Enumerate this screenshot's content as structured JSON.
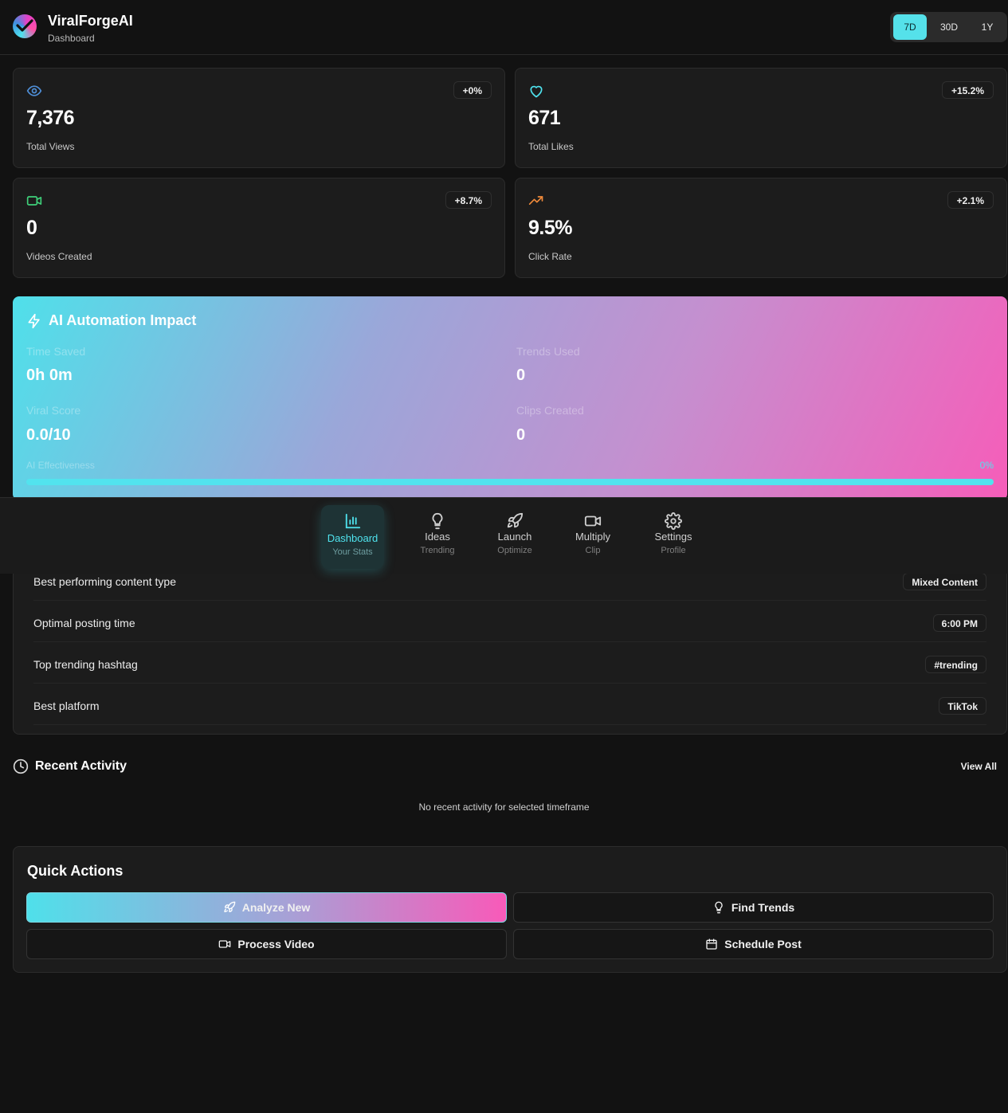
{
  "header": {
    "app_name": "ViralForgeAI",
    "subtitle": "Dashboard",
    "ranges": [
      {
        "label": "7D",
        "active": true
      },
      {
        "label": "30D",
        "active": false
      },
      {
        "label": "1Y",
        "active": false
      }
    ]
  },
  "stats": [
    {
      "icon": "eye-icon",
      "value": "7,376",
      "label": "Total Views",
      "change": "+0%",
      "color": "#4f8fd8"
    },
    {
      "icon": "heart-icon",
      "value": "671",
      "label": "Total Likes",
      "change": "+15.2%",
      "color": "#4fe3ee"
    },
    {
      "icon": "video-icon",
      "value": "0",
      "label": "Videos Created",
      "change": "+8.7%",
      "color": "#3fd07a"
    },
    {
      "icon": "trending-up-icon",
      "value": "9.5%",
      "label": "Click Rate",
      "change": "+2.1%",
      "color": "#f08a3a"
    }
  ],
  "impact": {
    "title": "AI Automation Impact",
    "metrics": [
      {
        "label": "Time Saved",
        "value": "0h 0m"
      },
      {
        "label": "Trends Used",
        "value": "0"
      },
      {
        "label": "Viral Score",
        "value": "0.0/10"
      },
      {
        "label": "Clips Created",
        "value": "0"
      }
    ],
    "effectiveness_label": "AI Effectiveness",
    "effectiveness_value": "0%",
    "effectiveness_fraction": 0
  },
  "nav": [
    {
      "icon": "bar-chart-icon",
      "label": "Dashboard",
      "sub": "Your Stats",
      "active": true
    },
    {
      "icon": "lightbulb-icon",
      "label": "Ideas",
      "sub": "Trending",
      "active": false
    },
    {
      "icon": "rocket-icon",
      "label": "Launch",
      "sub": "Optimize",
      "active": false
    },
    {
      "icon": "video-icon",
      "label": "Multiply",
      "sub": "Clip",
      "active": false
    },
    {
      "icon": "gear-icon",
      "label": "Settings",
      "sub": "Profile",
      "active": false
    }
  ],
  "insights": [
    {
      "label": "Best performing content type",
      "value": "Mixed Content"
    },
    {
      "label": "Optimal posting time",
      "value": "6:00 PM"
    },
    {
      "label": "Top trending hashtag",
      "value": "#trending"
    },
    {
      "label": "Best platform",
      "value": "TikTok"
    }
  ],
  "recent_activity": {
    "title": "Recent Activity",
    "view_all": "View All",
    "empty": "No recent activity for selected timeframe"
  },
  "quick_actions": {
    "title": "Quick Actions",
    "buttons": [
      {
        "icon": "rocket-icon",
        "label": "Analyze New",
        "primary": true
      },
      {
        "icon": "lightbulb-icon",
        "label": "Find Trends",
        "primary": false
      },
      {
        "icon": "video-icon",
        "label": "Process Video",
        "primary": false
      },
      {
        "icon": "calendar-icon",
        "label": "Schedule Post",
        "primary": false
      }
    ]
  }
}
